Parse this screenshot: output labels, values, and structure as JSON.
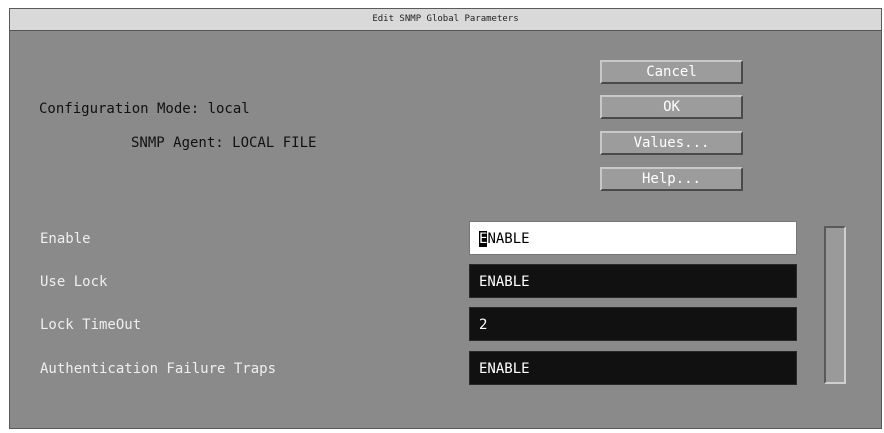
{
  "window": {
    "title": "Edit SNMP Global Parameters"
  },
  "info": {
    "config_mode": "Configuration Mode: local",
    "snmp_agent": "SNMP Agent: LOCAL FILE"
  },
  "buttons": {
    "cancel": "Cancel",
    "ok": "OK",
    "values": "Values...",
    "help": "Help..."
  },
  "fields": [
    {
      "label": "Enable",
      "value": "NABLE",
      "caret": "E"
    },
    {
      "label": "Use Lock",
      "value": "ENABLE"
    },
    {
      "label": "Lock TimeOut",
      "value": "2"
    },
    {
      "label": "Authentication Failure Traps",
      "value": "ENABLE"
    }
  ]
}
